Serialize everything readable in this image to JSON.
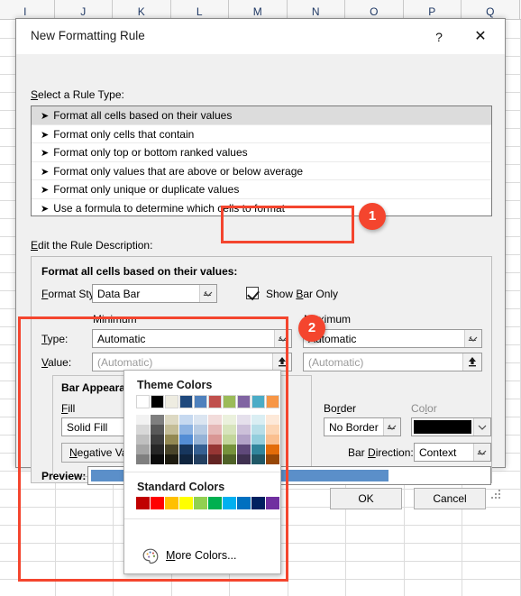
{
  "spreadsheet": {
    "column_headers": [
      "I",
      "J",
      "K",
      "L",
      "M",
      "N",
      "O",
      "P",
      "Q"
    ]
  },
  "dialog": {
    "title": "New Formatting Rule",
    "help_icon": "?",
    "close_icon": "✕",
    "rule_type_label": "Select a Rule Type:",
    "rule_types": [
      {
        "label": "Format all cells based on their values",
        "selected": true
      },
      {
        "label": "Format only cells that contain",
        "selected": false
      },
      {
        "label": "Format only top or bottom ranked values",
        "selected": false
      },
      {
        "label": "Format only values that are above or below average",
        "selected": false
      },
      {
        "label": "Format only unique or duplicate values",
        "selected": false
      },
      {
        "label": "Use a formula to determine which cells to format",
        "selected": false
      }
    ],
    "edit_rule_label": "Edit the Rule Description:",
    "description_heading": "Format all cells based on their values:",
    "format_style_label": "Format Style:",
    "format_style_value": "Data Bar",
    "show_bar_only_label": "Show Bar Only",
    "show_bar_only_checked": true,
    "minimum_label": "Minimum",
    "maximum_label": "Maximum",
    "type_label": "Type:",
    "value_label": "Value:",
    "minimum_type": "Automatic",
    "maximum_type": "Automatic",
    "minimum_value_placeholder": "(Automatic)",
    "maximum_value_placeholder": "(Automatic)",
    "bar_appearance_label": "Bar Appearance:",
    "fill_label": "Fill",
    "fill_value": "Solid Fill",
    "color_label": "Color",
    "fill_color": "#5b8fc9",
    "border_label": "Border",
    "border_value": "No Border",
    "border_color_label": "Color",
    "border_color": "#000000",
    "negative_value_button": "Negative Value an",
    "bar_direction_label": "Bar Direction:",
    "bar_direction_value": "Context",
    "preview_label": "Preview:",
    "preview_bar_color": "#5b8fc9",
    "ok_button": "OK",
    "cancel_button": "Cancel"
  },
  "color_popup": {
    "theme_colors_heading": "Theme Colors",
    "theme_top_row": [
      "#ffffff",
      "#000000",
      "#eeece1",
      "#1f497d",
      "#4f81bd",
      "#c0504d",
      "#9bbb59",
      "#8064a2",
      "#4bacc6",
      "#f79646"
    ],
    "theme_shades": [
      [
        "#f2f2f2",
        "#d8d8d8",
        "#bfbfbf",
        "#a5a5a5",
        "#7f7f7f"
      ],
      [
        "#7f7f7f",
        "#595959",
        "#3f3f3f",
        "#262626",
        "#0c0c0c"
      ],
      [
        "#ddd9c3",
        "#c4bd97",
        "#938953",
        "#494429",
        "#1d1b10"
      ],
      [
        "#c6d9f0",
        "#8db3e2",
        "#538dd5",
        "#17365d",
        "#0f243e"
      ],
      [
        "#dbe5f1",
        "#b8cce4",
        "#95b3d7",
        "#366092",
        "#244061"
      ],
      [
        "#f2dcdb",
        "#e5b8b7",
        "#d99694",
        "#963634",
        "#632423"
      ],
      [
        "#ebf1dd",
        "#d7e4bc",
        "#c3d69b",
        "#76923c",
        "#4f6228"
      ],
      [
        "#e5e0ec",
        "#ccc0d9",
        "#b2a2c7",
        "#5f497a",
        "#3f3151"
      ],
      [
        "#daeef3",
        "#b7dee8",
        "#92cddc",
        "#31859b",
        "#205867"
      ],
      [
        "#fde9d9",
        "#fcd5b4",
        "#fabf8f",
        "#e36c09",
        "#974706"
      ]
    ],
    "standard_colors_heading": "Standard Colors",
    "standard_colors": [
      "#c00000",
      "#ff0000",
      "#ffc000",
      "#ffff00",
      "#92d050",
      "#00b050",
      "#00b0f0",
      "#0070c0",
      "#002060",
      "#7030a0"
    ],
    "more_colors_label": "More Colors...",
    "more_colors_icon": "palette-icon"
  },
  "annotations": {
    "accent_color": "#f4452e",
    "badges": [
      {
        "number": "1"
      },
      {
        "number": "2"
      }
    ]
  }
}
